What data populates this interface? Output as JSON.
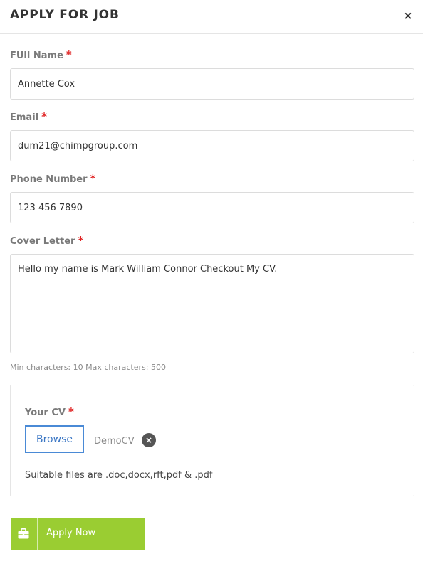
{
  "header": {
    "title": "APPLY FOR JOB",
    "close_symbol": "×"
  },
  "form": {
    "full_name": {
      "label": "FUll Name",
      "required_mark": "*",
      "value": "Annette Cox"
    },
    "email": {
      "label": "Email",
      "required_mark": "*",
      "value": "dum21@chimpgroup.com"
    },
    "phone": {
      "label": "Phone Number",
      "required_mark": "*",
      "value": "123 456 7890"
    },
    "cover_letter": {
      "label": "Cover Letter",
      "required_mark": "*",
      "value": "Hello my name is Mark William Connor Checkout My CV.",
      "hint": "Min characters: 10 Max characters: 500"
    }
  },
  "cv": {
    "label": "Your CV",
    "required_mark": "*",
    "browse_label": "Browse",
    "file_name": "DemoCV",
    "remove_symbol": "×",
    "note": "Suitable files are .doc,docx,rft,pdf & .pdf"
  },
  "apply_button": {
    "label": "Apply Now",
    "icon": "briefcase-icon"
  },
  "colors": {
    "accent": "#9acd32",
    "required": "#e02424",
    "browse_border": "#4a8ad6"
  }
}
